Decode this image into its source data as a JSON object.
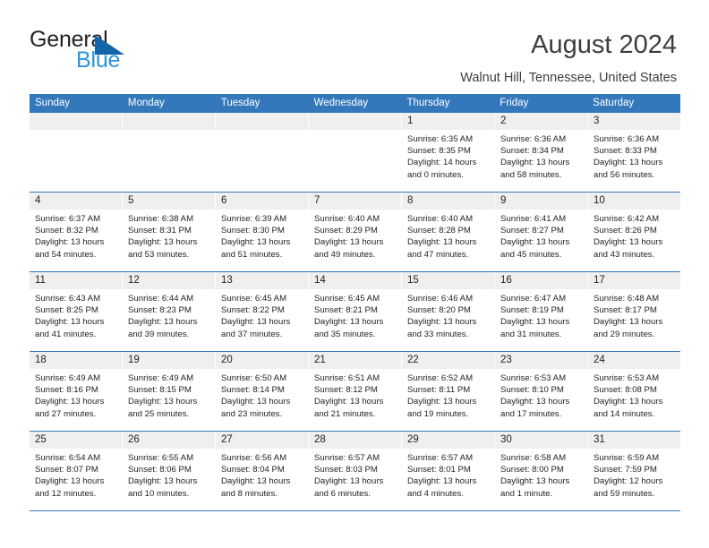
{
  "logo": {
    "word1": "General",
    "word2": "Blue",
    "triangle_color": "#1464aa",
    "word2_color": "#2a94dd"
  },
  "header": {
    "title": "August 2024",
    "location": "Walnut Hill, Tennessee, United States"
  },
  "calendar": {
    "header_bg": "#3478bc",
    "daynum_bg": "#efefef",
    "weekdays": [
      "Sunday",
      "Monday",
      "Tuesday",
      "Wednesday",
      "Thursday",
      "Friday",
      "Saturday"
    ],
    "weeks": [
      [
        {
          "day": "",
          "sunrise": "",
          "sunset": "",
          "daylight1": "",
          "daylight2": ""
        },
        {
          "day": "",
          "sunrise": "",
          "sunset": "",
          "daylight1": "",
          "daylight2": ""
        },
        {
          "day": "",
          "sunrise": "",
          "sunset": "",
          "daylight1": "",
          "daylight2": ""
        },
        {
          "day": "",
          "sunrise": "",
          "sunset": "",
          "daylight1": "",
          "daylight2": ""
        },
        {
          "day": "1",
          "sunrise": "Sunrise: 6:35 AM",
          "sunset": "Sunset: 8:35 PM",
          "daylight1": "Daylight: 14 hours",
          "daylight2": "and 0 minutes."
        },
        {
          "day": "2",
          "sunrise": "Sunrise: 6:36 AM",
          "sunset": "Sunset: 8:34 PM",
          "daylight1": "Daylight: 13 hours",
          "daylight2": "and 58 minutes."
        },
        {
          "day": "3",
          "sunrise": "Sunrise: 6:36 AM",
          "sunset": "Sunset: 8:33 PM",
          "daylight1": "Daylight: 13 hours",
          "daylight2": "and 56 minutes."
        }
      ],
      [
        {
          "day": "4",
          "sunrise": "Sunrise: 6:37 AM",
          "sunset": "Sunset: 8:32 PM",
          "daylight1": "Daylight: 13 hours",
          "daylight2": "and 54 minutes."
        },
        {
          "day": "5",
          "sunrise": "Sunrise: 6:38 AM",
          "sunset": "Sunset: 8:31 PM",
          "daylight1": "Daylight: 13 hours",
          "daylight2": "and 53 minutes."
        },
        {
          "day": "6",
          "sunrise": "Sunrise: 6:39 AM",
          "sunset": "Sunset: 8:30 PM",
          "daylight1": "Daylight: 13 hours",
          "daylight2": "and 51 minutes."
        },
        {
          "day": "7",
          "sunrise": "Sunrise: 6:40 AM",
          "sunset": "Sunset: 8:29 PM",
          "daylight1": "Daylight: 13 hours",
          "daylight2": "and 49 minutes."
        },
        {
          "day": "8",
          "sunrise": "Sunrise: 6:40 AM",
          "sunset": "Sunset: 8:28 PM",
          "daylight1": "Daylight: 13 hours",
          "daylight2": "and 47 minutes."
        },
        {
          "day": "9",
          "sunrise": "Sunrise: 6:41 AM",
          "sunset": "Sunset: 8:27 PM",
          "daylight1": "Daylight: 13 hours",
          "daylight2": "and 45 minutes."
        },
        {
          "day": "10",
          "sunrise": "Sunrise: 6:42 AM",
          "sunset": "Sunset: 8:26 PM",
          "daylight1": "Daylight: 13 hours",
          "daylight2": "and 43 minutes."
        }
      ],
      [
        {
          "day": "11",
          "sunrise": "Sunrise: 6:43 AM",
          "sunset": "Sunset: 8:25 PM",
          "daylight1": "Daylight: 13 hours",
          "daylight2": "and 41 minutes."
        },
        {
          "day": "12",
          "sunrise": "Sunrise: 6:44 AM",
          "sunset": "Sunset: 8:23 PM",
          "daylight1": "Daylight: 13 hours",
          "daylight2": "and 39 minutes."
        },
        {
          "day": "13",
          "sunrise": "Sunrise: 6:45 AM",
          "sunset": "Sunset: 8:22 PM",
          "daylight1": "Daylight: 13 hours",
          "daylight2": "and 37 minutes."
        },
        {
          "day": "14",
          "sunrise": "Sunrise: 6:45 AM",
          "sunset": "Sunset: 8:21 PM",
          "daylight1": "Daylight: 13 hours",
          "daylight2": "and 35 minutes."
        },
        {
          "day": "15",
          "sunrise": "Sunrise: 6:46 AM",
          "sunset": "Sunset: 8:20 PM",
          "daylight1": "Daylight: 13 hours",
          "daylight2": "and 33 minutes."
        },
        {
          "day": "16",
          "sunrise": "Sunrise: 6:47 AM",
          "sunset": "Sunset: 8:19 PM",
          "daylight1": "Daylight: 13 hours",
          "daylight2": "and 31 minutes."
        },
        {
          "day": "17",
          "sunrise": "Sunrise: 6:48 AM",
          "sunset": "Sunset: 8:17 PM",
          "daylight1": "Daylight: 13 hours",
          "daylight2": "and 29 minutes."
        }
      ],
      [
        {
          "day": "18",
          "sunrise": "Sunrise: 6:49 AM",
          "sunset": "Sunset: 8:16 PM",
          "daylight1": "Daylight: 13 hours",
          "daylight2": "and 27 minutes."
        },
        {
          "day": "19",
          "sunrise": "Sunrise: 6:49 AM",
          "sunset": "Sunset: 8:15 PM",
          "daylight1": "Daylight: 13 hours",
          "daylight2": "and 25 minutes."
        },
        {
          "day": "20",
          "sunrise": "Sunrise: 6:50 AM",
          "sunset": "Sunset: 8:14 PM",
          "daylight1": "Daylight: 13 hours",
          "daylight2": "and 23 minutes."
        },
        {
          "day": "21",
          "sunrise": "Sunrise: 6:51 AM",
          "sunset": "Sunset: 8:12 PM",
          "daylight1": "Daylight: 13 hours",
          "daylight2": "and 21 minutes."
        },
        {
          "day": "22",
          "sunrise": "Sunrise: 6:52 AM",
          "sunset": "Sunset: 8:11 PM",
          "daylight1": "Daylight: 13 hours",
          "daylight2": "and 19 minutes."
        },
        {
          "day": "23",
          "sunrise": "Sunrise: 6:53 AM",
          "sunset": "Sunset: 8:10 PM",
          "daylight1": "Daylight: 13 hours",
          "daylight2": "and 17 minutes."
        },
        {
          "day": "24",
          "sunrise": "Sunrise: 6:53 AM",
          "sunset": "Sunset: 8:08 PM",
          "daylight1": "Daylight: 13 hours",
          "daylight2": "and 14 minutes."
        }
      ],
      [
        {
          "day": "25",
          "sunrise": "Sunrise: 6:54 AM",
          "sunset": "Sunset: 8:07 PM",
          "daylight1": "Daylight: 13 hours",
          "daylight2": "and 12 minutes."
        },
        {
          "day": "26",
          "sunrise": "Sunrise: 6:55 AM",
          "sunset": "Sunset: 8:06 PM",
          "daylight1": "Daylight: 13 hours",
          "daylight2": "and 10 minutes."
        },
        {
          "day": "27",
          "sunrise": "Sunrise: 6:56 AM",
          "sunset": "Sunset: 8:04 PM",
          "daylight1": "Daylight: 13 hours",
          "daylight2": "and 8 minutes."
        },
        {
          "day": "28",
          "sunrise": "Sunrise: 6:57 AM",
          "sunset": "Sunset: 8:03 PM",
          "daylight1": "Daylight: 13 hours",
          "daylight2": "and 6 minutes."
        },
        {
          "day": "29",
          "sunrise": "Sunrise: 6:57 AM",
          "sunset": "Sunset: 8:01 PM",
          "daylight1": "Daylight: 13 hours",
          "daylight2": "and 4 minutes."
        },
        {
          "day": "30",
          "sunrise": "Sunrise: 6:58 AM",
          "sunset": "Sunset: 8:00 PM",
          "daylight1": "Daylight: 13 hours",
          "daylight2": "and 1 minute."
        },
        {
          "day": "31",
          "sunrise": "Sunrise: 6:59 AM",
          "sunset": "Sunset: 7:59 PM",
          "daylight1": "Daylight: 12 hours",
          "daylight2": "and 59 minutes."
        }
      ]
    ]
  }
}
